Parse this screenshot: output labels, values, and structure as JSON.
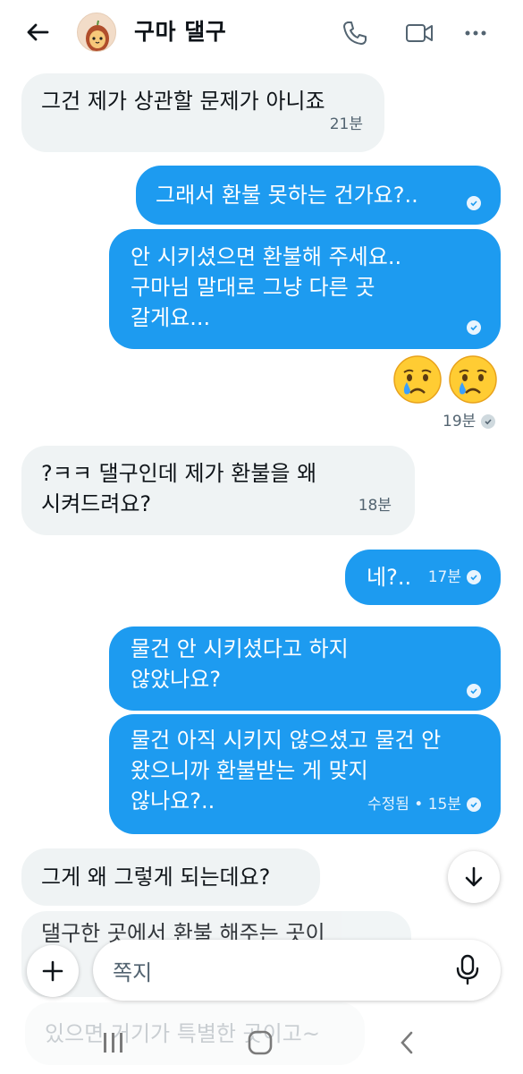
{
  "header": {
    "title": "구마 댈구",
    "icons": [
      "back-arrow-icon",
      "avatar",
      "phone-icon",
      "video-call-icon",
      "more-icon"
    ]
  },
  "messages": [
    {
      "dir": "in",
      "lines": "그건 제가 상관할 문제가 아니죠",
      "time": "21분"
    },
    {
      "dir": "out",
      "lines": "그래서 환불 못하는 건가요?..",
      "time": ""
    },
    {
      "dir": "out",
      "lines": "안 시키셨으면 환불해 주세요..\n구마님 말대로 그냥 다른 곳\n갈게요...",
      "time": ""
    },
    {
      "dir": "out",
      "emoji": "😢😢",
      "time": "19분"
    },
    {
      "dir": "in",
      "lines": "?ㅋㅋ 댈구인데 제가 환불을 왜\n시켜드려요?",
      "time": "18분"
    },
    {
      "dir": "out",
      "lines": "네?..",
      "time": "17분"
    },
    {
      "dir": "out",
      "lines": "물건 안 시키셨다고 하지\n않았나요?",
      "time": ""
    },
    {
      "dir": "out",
      "lines": "물건 아직 시키지 않으셨고 물건 안\n왔으니까 환불받는 게 맞지\n않나요?..",
      "time": "수정됨 • 15분"
    },
    {
      "dir": "in",
      "lines": "그게 왜 그렇게 되는데요?",
      "time": ""
    }
  ],
  "partial_message": "댈구한 곳에서 환불 해주는 곳이",
  "partial_message_tail": "있으면 거기가 특별한 곳이고~",
  "composer": {
    "placeholder": "쪽지"
  },
  "colors": {
    "outgoing": "#1d9bf0",
    "incoming": "#eff3f4",
    "text": "#0f1419",
    "muted": "#536471"
  }
}
